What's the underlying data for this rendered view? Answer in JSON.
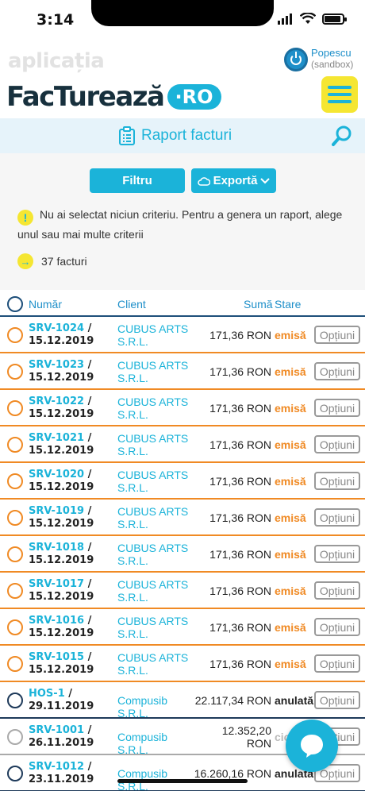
{
  "status_bar": {
    "time": "3:14"
  },
  "header": {
    "app_small": "aplicația",
    "brand_name": "FacTurează",
    "brand_suffix": "·RO",
    "user_name": "Popescu",
    "user_env": "(sandbox)"
  },
  "title_bar": {
    "title": "Raport facturi"
  },
  "filters": {
    "filter_label": "Filtru",
    "export_label": "Exportă",
    "info_text": "Nu ai selectat niciun criteriu. Pentru a genera un raport, alege unul sau mai multe criterii",
    "count_text": "37 facturi"
  },
  "table": {
    "headers": {
      "number": "Număr",
      "client": "Client",
      "sum": "Sumă",
      "status": "Stare"
    },
    "option_label": "Opțiuni",
    "rows": [
      {
        "id": "SRV-1024",
        "date": "15.12.2019",
        "client": "CUBUS ARTS S.R.L.",
        "amount": "171,36 RON",
        "status": "emisă",
        "color": "orange"
      },
      {
        "id": "SRV-1023",
        "date": "15.12.2019",
        "client": "CUBUS ARTS S.R.L.",
        "amount": "171,36 RON",
        "status": "emisă",
        "color": "orange"
      },
      {
        "id": "SRV-1022",
        "date": "15.12.2019",
        "client": "CUBUS ARTS S.R.L.",
        "amount": "171,36 RON",
        "status": "emisă",
        "color": "orange"
      },
      {
        "id": "SRV-1021",
        "date": "15.12.2019",
        "client": "CUBUS ARTS S.R.L.",
        "amount": "171,36 RON",
        "status": "emisă",
        "color": "orange"
      },
      {
        "id": "SRV-1020",
        "date": "15.12.2019",
        "client": "CUBUS ARTS S.R.L.",
        "amount": "171,36 RON",
        "status": "emisă",
        "color": "orange"
      },
      {
        "id": "SRV-1019",
        "date": "15.12.2019",
        "client": "CUBUS ARTS S.R.L.",
        "amount": "171,36 RON",
        "status": "emisă",
        "color": "orange"
      },
      {
        "id": "SRV-1018",
        "date": "15.12.2019",
        "client": "CUBUS ARTS S.R.L.",
        "amount": "171,36 RON",
        "status": "emisă",
        "color": "orange"
      },
      {
        "id": "SRV-1017",
        "date": "15.12.2019",
        "client": "CUBUS ARTS S.R.L.",
        "amount": "171,36 RON",
        "status": "emisă",
        "color": "orange"
      },
      {
        "id": "SRV-1016",
        "date": "15.12.2019",
        "client": "CUBUS ARTS S.R.L.",
        "amount": "171,36 RON",
        "status": "emisă",
        "color": "orange"
      },
      {
        "id": "SRV-1015",
        "date": "15.12.2019",
        "client": "CUBUS ARTS S.R.L.",
        "amount": "171,36 RON",
        "status": "emisă",
        "color": "orange"
      },
      {
        "id": "HOS-1",
        "date": "29.11.2019",
        "client": "Compusib S.R.L.",
        "amount": "22.117,34 RON",
        "status": "anulată",
        "color": "black"
      },
      {
        "id": "SRV-1001",
        "date": "26.11.2019",
        "client": "Compusib S.R.L.",
        "amount": "12.352,20 RON",
        "status": "ciornă",
        "color": "grey"
      },
      {
        "id": "SRV-1012",
        "date": "23.11.2019",
        "client": "Compusib S.R.L.",
        "amount": "16.260,16 RON",
        "status": "anulată",
        "color": "black"
      }
    ]
  },
  "colors": {
    "accent": "#1bb3d9",
    "brand_dark": "#17303d",
    "highlight": "#f5e632",
    "orange": "#f08a24"
  }
}
